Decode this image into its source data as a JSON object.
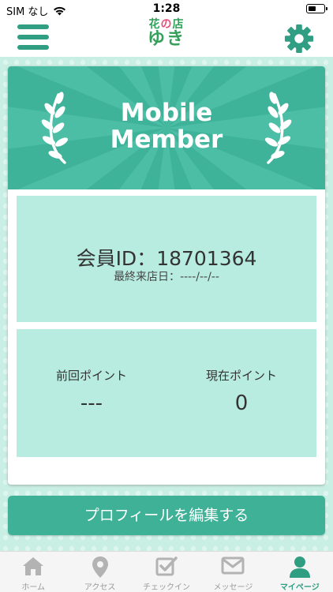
{
  "status_bar": {
    "carrier": "SIM なし",
    "time": "1:28"
  },
  "header": {
    "logo_top_part1": "花",
    "logo_top_part2": "の",
    "logo_top_part3": "店",
    "logo_bottom": "ゆき",
    "menu_icon": "hamburger-icon",
    "settings_icon": "gear-icon"
  },
  "banner": {
    "title_line1": "Mobile",
    "title_line2": "Member"
  },
  "member": {
    "id_label": "会員ID：",
    "id_value": "18701364",
    "last_visit_label": "最終来店日：",
    "last_visit_value": "----/--/--"
  },
  "points": {
    "previous_label": "前回ポイント",
    "previous_value": "---",
    "current_label": "現在ポイント",
    "current_value": "0"
  },
  "edit_profile_label": "プロフィールを編集する",
  "tabs": [
    {
      "label": "ホーム",
      "icon": "home-icon"
    },
    {
      "label": "アクセス",
      "icon": "map-pin-icon"
    },
    {
      "label": "チェックイン",
      "icon": "checkin-icon"
    },
    {
      "label": "メッセージ",
      "icon": "mail-icon"
    },
    {
      "label": "マイページ",
      "icon": "user-icon",
      "active": true
    }
  ],
  "colors": {
    "accent": "#3eb39a",
    "panel": "#b9ece0",
    "background": "#c9eee3"
  }
}
